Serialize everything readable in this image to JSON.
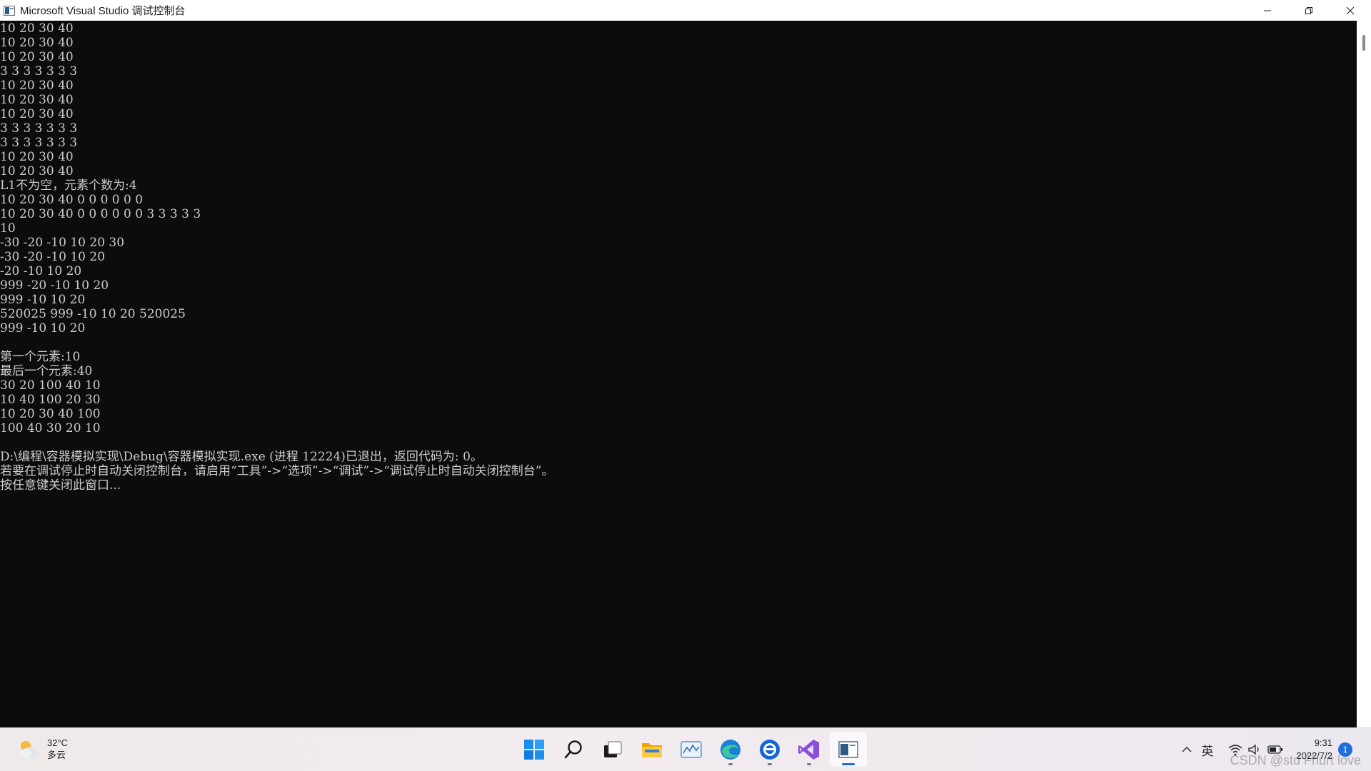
{
  "window": {
    "title": "Microsoft Visual Studio 调试控制台",
    "controls": {
      "minimize_glyph": "—",
      "restore_glyph": "❐",
      "close_glyph": "✕"
    }
  },
  "console": {
    "background": "#0c0c0c",
    "foreground": "#cccccc",
    "lines": [
      "10 20 30 40",
      "10 20 30 40",
      "10 20 30 40",
      "3 3 3 3 3 3 3",
      "10 20 30 40",
      "10 20 30 40",
      "10 20 30 40",
      "3 3 3 3 3 3 3",
      "3 3 3 3 3 3 3",
      "10 20 30 40",
      "10 20 30 40",
      "L1不为空，元素个数为:4",
      "10 20 30 40 0 0 0 0 0 0",
      "10 20 30 40 0 0 0 0 0 0 3 3 3 3 3",
      "10",
      "-30 -20 -10 10 20 30",
      "-30 -20 -10 10 20",
      "-20 -10 10 20",
      "999 -20 -10 10 20",
      "999 -10 10 20",
      "520025 999 -10 10 20 520025",
      "999 -10 10 20",
      "",
      "第一个元素:10",
      "最后一个元素:40",
      "30 20 100 40 10",
      "10 40 100 20 30",
      "10 20 30 40 100",
      "100 40 30 20 10",
      "",
      "D:\\编程\\容器模拟实现\\Debug\\容器模拟实现.exe (进程 12224)已退出，返回代码为: 0。",
      "若要在调试停止时自动关闭控制台，请启用“工具”->“选项”->“调试”->“调试停止时自动关闭控制台”。",
      "按任意键关闭此窗口..."
    ]
  },
  "taskbar": {
    "weather": {
      "temperature": "32°C",
      "condition": "多云"
    },
    "apps": [
      {
        "name": "start-icon",
        "running": false,
        "active": false
      },
      {
        "name": "search-icon",
        "running": false,
        "active": false
      },
      {
        "name": "task-view-icon",
        "running": false,
        "active": false
      },
      {
        "name": "file-explorer-icon",
        "running": false,
        "active": false
      },
      {
        "name": "performance-monitor-icon",
        "running": false,
        "active": false
      },
      {
        "name": "edge-icon",
        "running": true,
        "active": false
      },
      {
        "name": "qq-icon",
        "running": true,
        "active": false
      },
      {
        "name": "visual-studio-icon",
        "running": true,
        "active": false
      },
      {
        "name": "console-icon",
        "running": true,
        "active": true
      }
    ],
    "tray": {
      "ime": "英",
      "time": "9:31",
      "date": "2022/7/2",
      "notification_count": "1"
    },
    "accent": "#1e6fd9"
  },
  "watermark": "CSDN @std Fhurt  love"
}
